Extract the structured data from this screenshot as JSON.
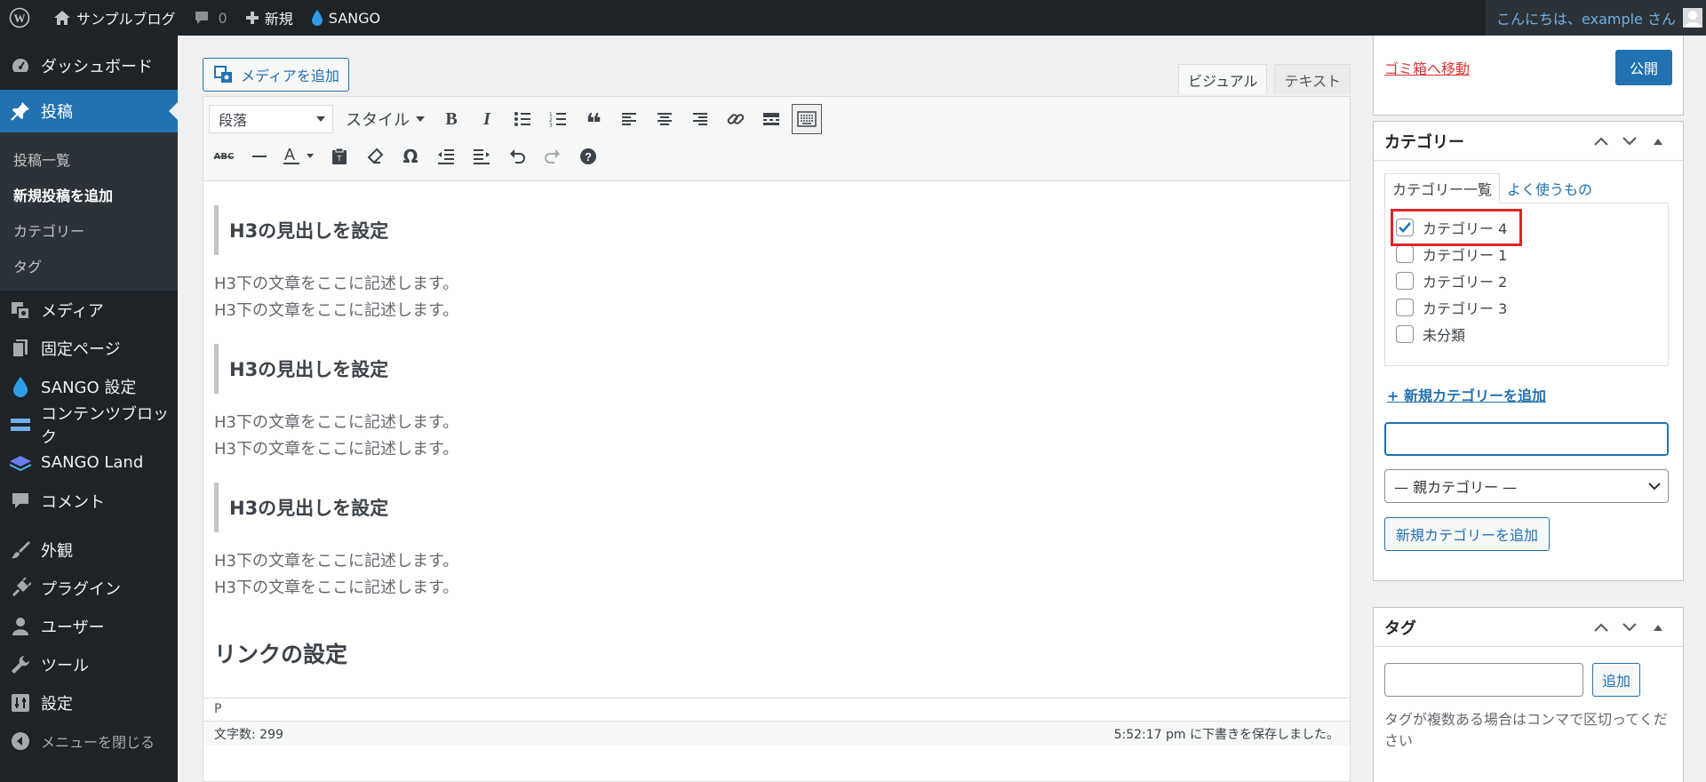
{
  "adminbar": {
    "site_name": "サンプルブログ",
    "comments_count": "0",
    "new_label": "新規",
    "theme_label": "SANGO",
    "greeting": "こんにちは、example さん"
  },
  "sidebar": {
    "dashboard": "ダッシュボード",
    "posts": "投稿",
    "posts_submenu": [
      "投稿一覧",
      "新規投稿を追加",
      "カテゴリー",
      "タグ"
    ],
    "media": "メディア",
    "pages": "固定ページ",
    "sango_settings": "SANGO 設定",
    "content_blocks": "コンテンツブロック",
    "sango_land": "SANGO Land",
    "comments": "コメント",
    "appearance": "外観",
    "plugins": "プラグイン",
    "users": "ユーザー",
    "tools": "ツール",
    "settings": "設定",
    "collapse": "メニューを閉じる"
  },
  "editor": {
    "add_media": "メディアを追加",
    "tab_visual": "ビジュアル",
    "tab_text": "テキスト",
    "format_select": "段落",
    "style_select": "スタイル",
    "blocks": [
      {
        "heading": "H3の見出しを設定",
        "lines": [
          "H3下の文章をここに記述します。",
          "H3下の文章をここに記述します。"
        ]
      },
      {
        "heading": "H3の見出しを設定",
        "lines": [
          "H3下の文章をここに記述します。",
          "H3下の文章をここに記述します。"
        ]
      },
      {
        "heading": "H3の見出しを設定",
        "lines": [
          "H3下の文章をここに記述します。",
          "H3下の文章をここに記述します。"
        ]
      }
    ],
    "h2_partial": "リンクの設定",
    "path": "P",
    "word_count": "文字数: 299",
    "save_status": "5:52:17 pm に下書きを保存しました。"
  },
  "publish": {
    "trash_link": "ゴミ箱へ移動",
    "publish_button": "公開"
  },
  "categories": {
    "title": "カテゴリー",
    "tab_all": "カテゴリー一覧",
    "tab_popular": "よく使うもの",
    "items": [
      {
        "label": "カテゴリー 4",
        "checked": true
      },
      {
        "label": "カテゴリー 1",
        "checked": false
      },
      {
        "label": "カテゴリー 2",
        "checked": false
      },
      {
        "label": "カテゴリー 3",
        "checked": false
      },
      {
        "label": "未分類",
        "checked": false
      }
    ],
    "add_new_link": "+ 新規カテゴリーを追加",
    "new_input_value": "",
    "parent_select": "— 親カテゴリー —",
    "add_button": "新規カテゴリーを追加"
  },
  "tags": {
    "title": "タグ",
    "input_value": "",
    "add_button": "追加",
    "hint": "タグが複数ある場合はコンマで区切ってください"
  },
  "colors": {
    "admin_dark": "#1d2327",
    "accent": "#2271b1",
    "danger": "#d63638",
    "highlight_box": "#e02424"
  }
}
